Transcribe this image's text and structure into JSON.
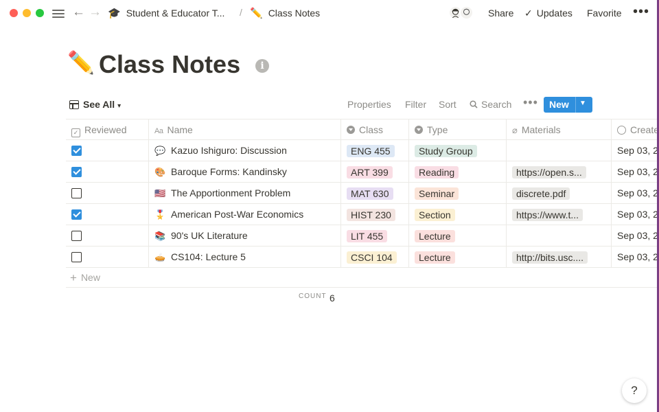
{
  "topbar": {
    "breadcrumb": [
      {
        "emoji": "🎓",
        "label": "Student & Educator T..."
      },
      {
        "emoji": "✏️",
        "label": "Class Notes"
      }
    ],
    "separator": "/",
    "actions": {
      "share": "Share",
      "updates": "Updates",
      "favorite": "Favorite",
      "more": "•••"
    }
  },
  "page": {
    "emoji": "✏️",
    "title": "Class Notes",
    "info": "i"
  },
  "view": {
    "label": "See All",
    "tools": {
      "properties": "Properties",
      "filter": "Filter",
      "sort": "Sort",
      "search": "Search",
      "more": "•••"
    },
    "new_label": "New"
  },
  "table": {
    "columns": [
      "Reviewed",
      "Name",
      "Class",
      "Type",
      "Materials",
      "Create"
    ],
    "rows": [
      {
        "reviewed": true,
        "emoji": "💬",
        "name": "Kazuo Ishiguro: Discussion",
        "class": "ENG 455",
        "class_color": "#dde8f5",
        "type": "Study Group",
        "type_color": "#dcebe5",
        "materials": "",
        "created": "Sep 03, 2"
      },
      {
        "reviewed": true,
        "emoji": "🎨",
        "name": "Baroque Forms: Kandinsky",
        "class": "ART 399",
        "class_color": "#f9dde4",
        "type": "Reading",
        "type_color": "#f9dde4",
        "materials": "https://open.s...",
        "created": "Sep 03, 2"
      },
      {
        "reviewed": false,
        "emoji": "🇺🇸",
        "name": "The Apportionment Problem",
        "class": "MAT 630",
        "class_color": "#e7def3",
        "type": "Seminar",
        "type_color": "#fbe4d8",
        "materials": "discrete.pdf",
        "created": "Sep 03, 2"
      },
      {
        "reviewed": true,
        "emoji": "🎖️",
        "name": "American Post-War Economics",
        "class": "HIST 230",
        "class_color": "#f3e4e0",
        "type": "Section",
        "type_color": "#fbf0d3",
        "materials": "https://www.t...",
        "created": "Sep 03, 2"
      },
      {
        "reviewed": false,
        "emoji": "📚",
        "name": "90's UK Literature",
        "class": "LIT 455",
        "class_color": "#f9dde4",
        "type": "Lecture",
        "type_color": "#fbe0dd",
        "materials": "",
        "created": "Sep 03, 2"
      },
      {
        "reviewed": false,
        "emoji": "🥧",
        "name": "CS104: Lecture 5",
        "class": "CSCI 104",
        "class_color": "#fbf0d3",
        "type": "Lecture",
        "type_color": "#fbe0dd",
        "materials": "http://bits.usc....",
        "created": "Sep 03, 2"
      }
    ],
    "new_row_label": "New",
    "count_label": "COUNT",
    "count_value": "6"
  },
  "help": "?"
}
